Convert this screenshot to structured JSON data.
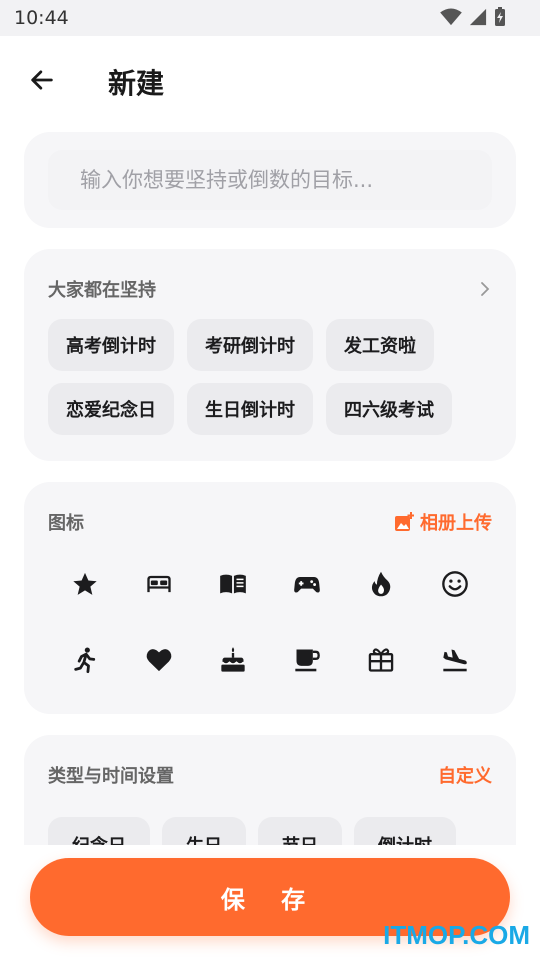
{
  "status_bar": {
    "time": "10:44"
  },
  "header": {
    "title": "新建"
  },
  "goal_input": {
    "placeholder": "输入你想要坚持或倒数的目标..."
  },
  "popular": {
    "title": "大家都在坚持",
    "chips": [
      "高考倒计时",
      "考研倒计时",
      "发工资啦",
      "恋爱纪念日",
      "生日倒计时",
      "四六级考试"
    ]
  },
  "icons_section": {
    "title": "图标",
    "upload_label": "相册上传",
    "icons": [
      "star-icon",
      "bed-icon",
      "book-icon",
      "gamepad-icon",
      "fire-icon",
      "smiley-icon",
      "running-icon",
      "heart-icon",
      "cake-icon",
      "coffee-icon",
      "gift-icon",
      "plane-landing-icon"
    ]
  },
  "type_section": {
    "title": "类型与时间设置",
    "custom_label": "自定义",
    "types": [
      "纪念日",
      "生日",
      "节日",
      "倒计时"
    ]
  },
  "save_button": {
    "label": "保 存"
  },
  "watermark": "ITMOP.COM",
  "colors": {
    "accent": "#ff6a2e",
    "card": "#f6f6f8",
    "chip": "#ebebee"
  }
}
